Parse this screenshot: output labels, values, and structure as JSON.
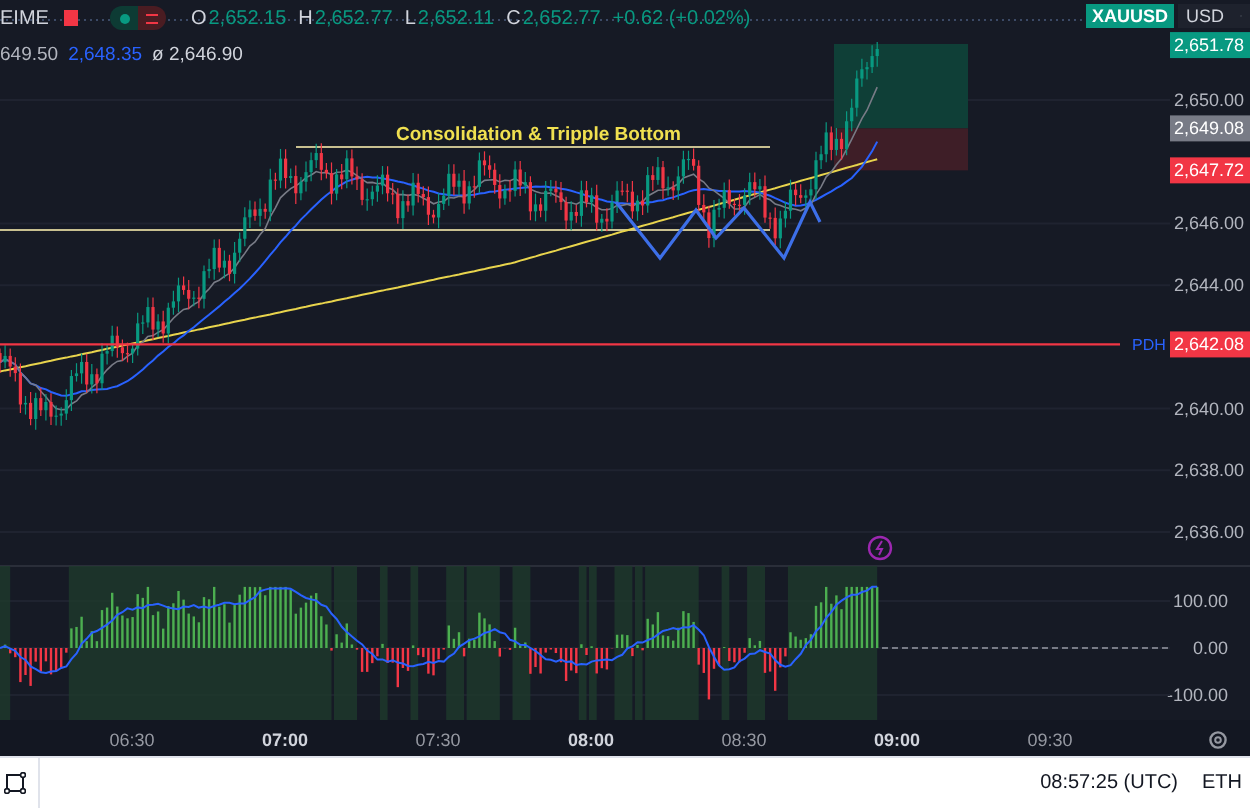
{
  "header": {
    "symbol_fragment": "EIME",
    "ohlc": [
      {
        "label": "O",
        "value": "2,652.15"
      },
      {
        "label": "H",
        "value": "2,652.77"
      },
      {
        "label": "L",
        "value": "2,652.11"
      },
      {
        "label": "C",
        "value": "2,652.77"
      }
    ],
    "change": "+0.62 (+0.02%)"
  },
  "symbol_badge": "XAUUSD",
  "currency": "USD",
  "indicator_legend": [
    {
      "text": "649.50",
      "color": "#b2b5be"
    },
    {
      "text": "2,648.35",
      "color": "#2962ff"
    },
    {
      "text": "ø 2,646.90",
      "color": "#d1d4dc"
    }
  ],
  "annotation": "Consolidation & Tripple Bottom",
  "price_axis": {
    "ticks": [
      "2,650.00",
      "2,646.00",
      "2,644.00",
      "2,640.00",
      "2,638.00",
      "2,636.00"
    ],
    "labels": [
      {
        "text": "2,651.78",
        "color": "#089981"
      },
      {
        "text": "2,649.08",
        "color": "#787b86"
      },
      {
        "text": "2,647.72",
        "color": "#f23645"
      },
      {
        "text": "2,642.08",
        "color": "#f23645",
        "line_tag": "PDH"
      }
    ]
  },
  "oscillator_axis": {
    "ticks": [
      "100.00",
      "0.00",
      "-100.00"
    ]
  },
  "time_axis": [
    {
      "label": "06:30",
      "major": false
    },
    {
      "label": "07:00",
      "major": true
    },
    {
      "label": "07:30",
      "major": false
    },
    {
      "label": "08:00",
      "major": true
    },
    {
      "label": "08:30",
      "major": false
    },
    {
      "label": "09:00",
      "major": true
    },
    {
      "label": "09:30",
      "major": false
    }
  ],
  "status_bar": {
    "time": "08:57:25 (UTC)",
    "session": "ETH"
  }
}
